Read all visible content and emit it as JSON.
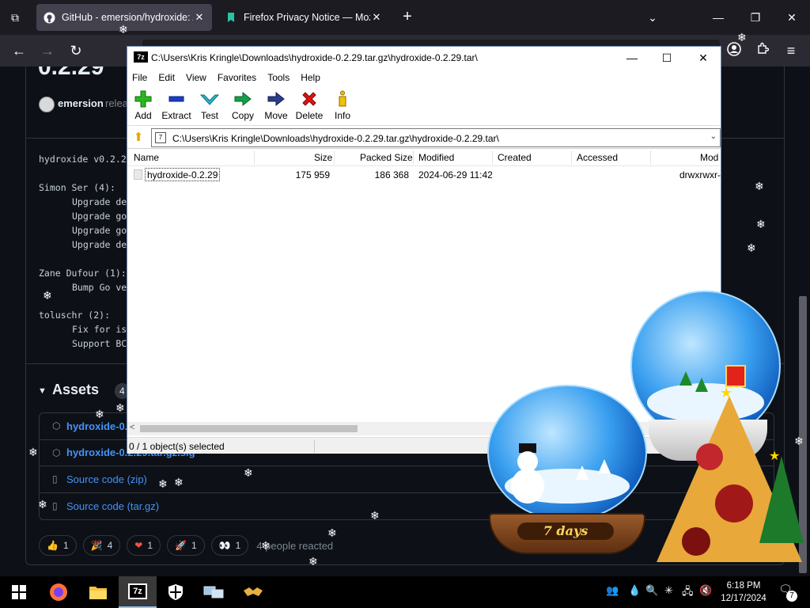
{
  "browser": {
    "tabs": [
      {
        "title": "GitHub - emersion/hydroxide: A",
        "favicon": "github-icon",
        "active": true
      },
      {
        "title": "Firefox Privacy Notice — Mozill",
        "favicon": "firefox-doc-icon",
        "active": false
      }
    ],
    "close_glyph": "✕",
    "new_tab_glyph": "+",
    "tab_list_glyph": "⧉",
    "overflow_glyph": "⌄",
    "window_controls": [
      "—",
      "❐",
      "✕"
    ],
    "nav": {
      "back": "←",
      "forward": "→",
      "reload": "↻",
      "menu": "≡"
    }
  },
  "github": {
    "version_heading": "0.2.29",
    "author": "emersion",
    "author_rest": "relea",
    "changelog": {
      "header": "hydroxide v0.2.2",
      "groups": [
        {
          "author": "Simon Ser (4):",
          "lines": [
            "Upgrade de",
            "Upgrade go",
            "Upgrade go",
            "Upgrade de"
          ]
        },
        {
          "author": "Zane Dufour (1):",
          "lines": [
            "Bump Go ve"
          ]
        },
        {
          "author": "toluschr (2):",
          "lines": [
            "Fix for is",
            "Support BC"
          ]
        }
      ]
    },
    "assets": {
      "title": "Assets",
      "count": "4",
      "items": [
        {
          "label": "hydroxide-0.",
          "icon": "package-icon",
          "bold": true
        },
        {
          "label": "hydroxide-0.2.29.tar.gz.sig",
          "icon": "package-icon",
          "bold": true
        },
        {
          "label": "Source code (zip)",
          "icon": "file-zip-icon",
          "bold": false
        },
        {
          "label": "Source code (tar.gz)",
          "icon": "file-zip-icon",
          "bold": false
        }
      ]
    },
    "reactions": [
      {
        "emoji": "👍",
        "count": "1"
      },
      {
        "emoji": "🎉",
        "count": "4"
      },
      {
        "emoji": "❤",
        "count": "1"
      },
      {
        "emoji": "🚀",
        "count": "1"
      },
      {
        "emoji": "👀",
        "count": "1"
      }
    ],
    "reactions_summary": "4 people reacted"
  },
  "sevenzip": {
    "title": "C:\\Users\\Kris Kringle\\Downloads\\hydroxide-0.2.29.tar.gz\\hydroxide-0.2.29.tar\\",
    "logo_text": "7z",
    "menu": [
      "File",
      "Edit",
      "View",
      "Favorites",
      "Tools",
      "Help"
    ],
    "toolbar": [
      {
        "label": "Add",
        "icon": "plus-icon"
      },
      {
        "label": "Extract",
        "icon": "minus-icon"
      },
      {
        "label": "Test",
        "icon": "check-icon"
      },
      {
        "label": "Copy",
        "icon": "arrow-right-icon"
      },
      {
        "label": "Move",
        "icon": "move-arrow-icon"
      },
      {
        "label": "Delete",
        "icon": "x-icon"
      },
      {
        "label": "Info",
        "icon": "info-icon"
      }
    ],
    "address": "C:\\Users\\Kris Kringle\\Downloads\\hydroxide-0.2.29.tar.gz\\hydroxide-0.2.29.tar\\",
    "columns": [
      "Name",
      "Size",
      "Packed Size",
      "Modified",
      "Created",
      "Accessed",
      "Mod"
    ],
    "rows": [
      {
        "name": "hydroxide-0.2.29",
        "size": "175 959",
        "packed": "186 368",
        "modified": "2024-06-29 11:42",
        "created": "",
        "accessed": "",
        "mode": "drwxrwxr-"
      }
    ],
    "status": "0 / 1 object(s) selected",
    "window_controls": [
      "—",
      "☐",
      "✕"
    ]
  },
  "decorations": {
    "days_label": "7 days"
  },
  "taskbar": {
    "apps": [
      {
        "name": "start",
        "icon": "windows-logo-icon"
      },
      {
        "name": "firefox",
        "icon": "firefox-icon"
      },
      {
        "name": "file-explorer",
        "icon": "folder-icon"
      },
      {
        "name": "7zip",
        "icon": "7zip-icon",
        "label": "7z"
      },
      {
        "name": "defender",
        "icon": "shield-icon"
      },
      {
        "name": "network-app",
        "icon": "computers-icon"
      },
      {
        "name": "handshake-app",
        "icon": "handshake-icon"
      }
    ],
    "time": "6:18 PM",
    "date": "12/17/2024",
    "notifications": "7"
  },
  "colors": {
    "accent_link": "#4493f8",
    "page_bg": "#0d1117",
    "taskbar_bg": "#000000"
  }
}
